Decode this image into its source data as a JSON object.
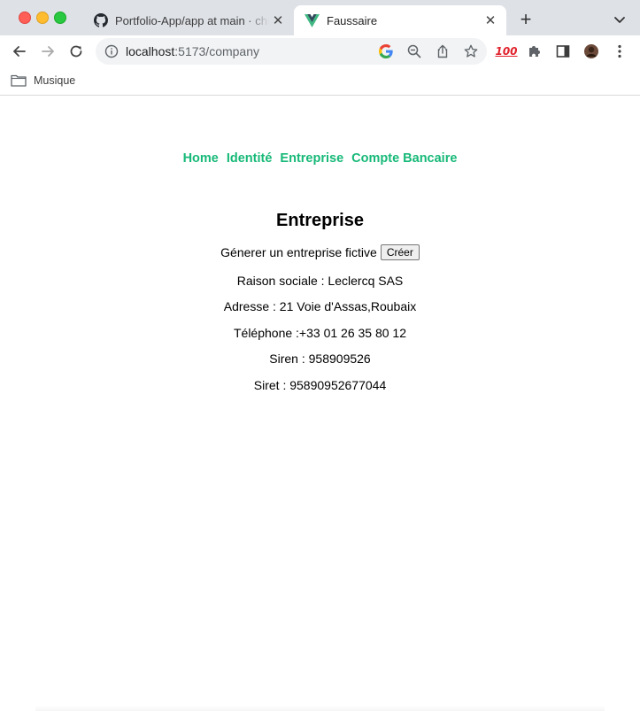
{
  "browser": {
    "tabs": [
      {
        "title": "Portfolio-App/app at main · chr",
        "icon": "github-icon",
        "active": false
      },
      {
        "title": "Faussaire",
        "icon": "vue-icon",
        "active": true
      }
    ],
    "address": {
      "host": "localhost",
      "path": ":5173/company"
    },
    "bookmarks": [
      {
        "label": "Musique",
        "icon": "folder-icon"
      }
    ],
    "colors": {
      "tabstrip": "#dee1e6",
      "accent": "#17b978"
    }
  },
  "page": {
    "nav": [
      {
        "label": "Home"
      },
      {
        "label": "Identité"
      },
      {
        "label": "Entreprise"
      },
      {
        "label": "Compte Bancaire"
      }
    ],
    "title": "Entreprise",
    "generate_label": "Génerer un entreprise fictive",
    "create_button": "Créer",
    "company": {
      "raison_sociale": "Raison sociale : Leclercq SAS",
      "adresse": "Adresse : 21 Voie d'Assas,Roubaix",
      "telephone": "Téléphone :+33 01 26 35 80 12",
      "siren": "Siren : 958909526",
      "siret": "Siret : 95890952677044"
    }
  }
}
